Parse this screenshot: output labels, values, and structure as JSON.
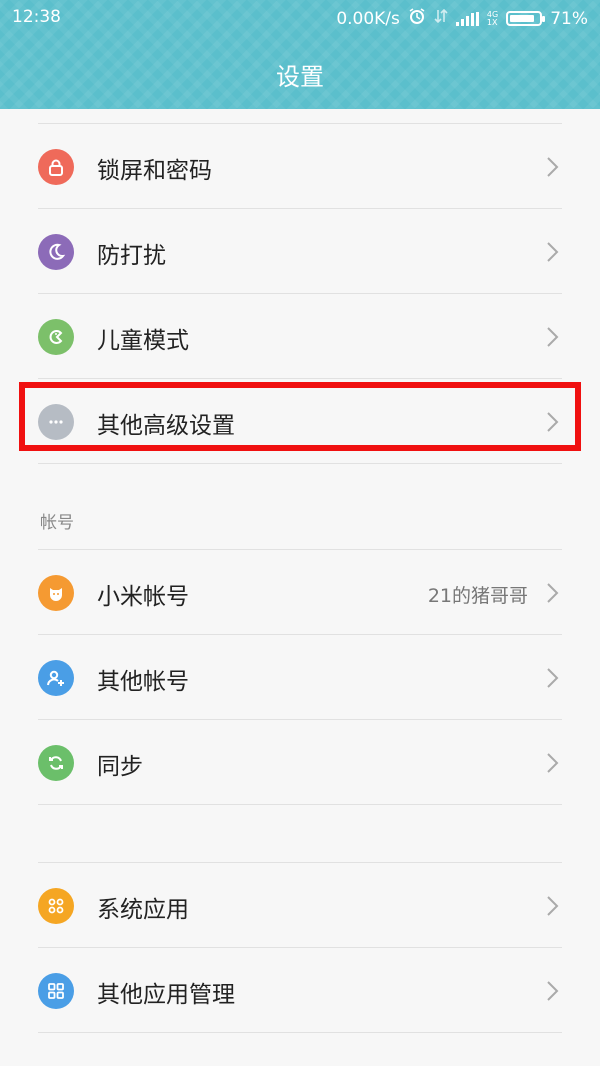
{
  "status_bar": {
    "time": "12:38",
    "speed": "0.00K/s",
    "battery": "71%",
    "network": "4G\n1X",
    "icons": [
      "alarm-icon",
      "data-arrows-icon",
      "signal-icon",
      "network-type-icon",
      "battery-icon"
    ]
  },
  "header": {
    "title": "设置"
  },
  "groups": {
    "top_items": [
      {
        "label": "锁屏和密码",
        "icon": "lock-icon",
        "color": "#ef6a5a"
      },
      {
        "label": "防打扰",
        "icon": "moon-icon",
        "color": "#8c6bb8"
      },
      {
        "label": "儿童模式",
        "icon": "child-mode-icon",
        "color": "#7cc06a"
      },
      {
        "label": "其他高级设置",
        "icon": "more-icon",
        "color": "#b6bcc4"
      }
    ],
    "account_section_title": "帐号",
    "account_items": [
      {
        "label": "小米帐号",
        "value": "21的猪哥哥",
        "icon": "mi-account-icon",
        "color": "#f59a32"
      },
      {
        "label": "其他帐号",
        "icon": "add-user-icon",
        "color": "#4a9ee6"
      },
      {
        "label": "同步",
        "icon": "sync-icon",
        "color": "#6bbf6a"
      }
    ],
    "app_items": [
      {
        "label": "系统应用",
        "icon": "system-apps-icon",
        "color": "#f5a623"
      },
      {
        "label": "其他应用管理",
        "icon": "apps-manage-icon",
        "color": "#4a9ee6"
      }
    ]
  },
  "colors": {
    "header_bg": "#5bbfcc",
    "highlight": "#f01010",
    "page_bg": "#f7f7f7"
  }
}
